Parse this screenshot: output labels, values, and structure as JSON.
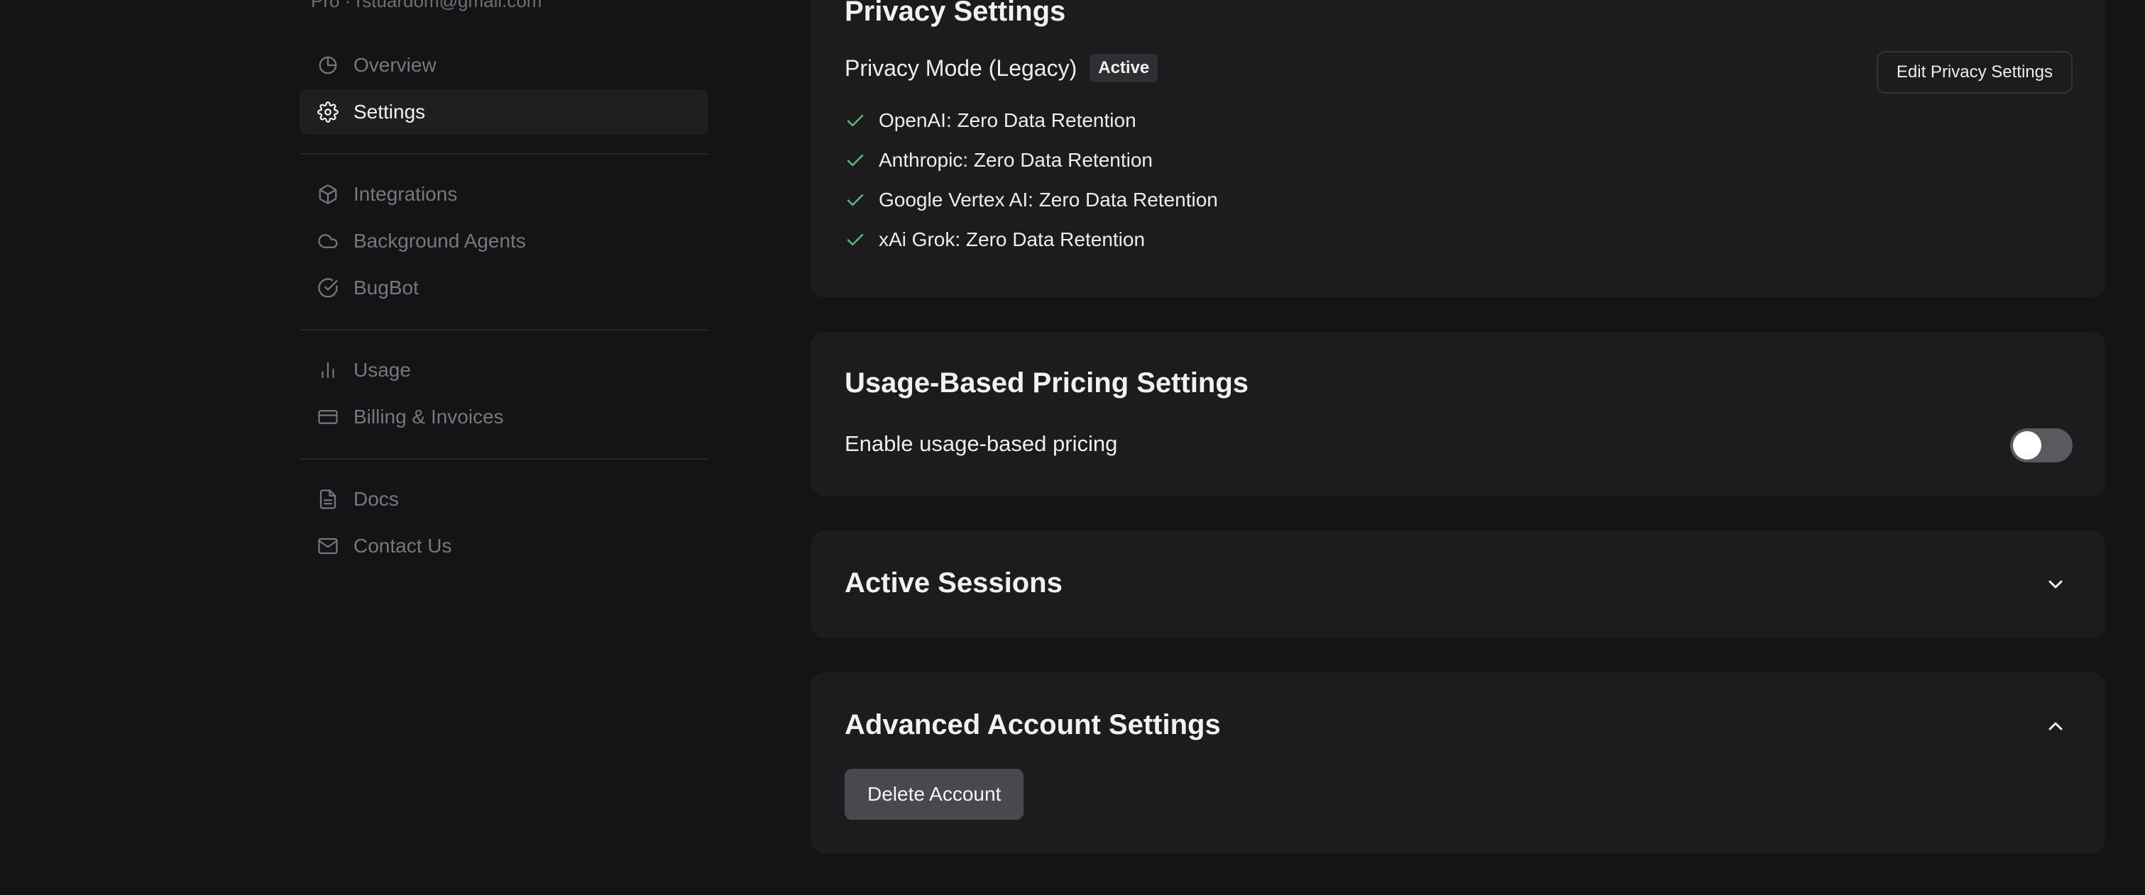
{
  "colors": {
    "background": "#141416",
    "card": "#1c1c1f",
    "sidebar_active": "#1f1f22",
    "text_primary": "#ededee",
    "text_muted": "#77777c",
    "check_green": "#5bb974",
    "toggle_off": "#5a5a5e",
    "delete_button": "#49494d"
  },
  "sidebar": {
    "account_line": "Pro · rstuardom@gmail.com",
    "items": [
      {
        "label": "Overview",
        "icon": "pie-chart-icon",
        "active": false
      },
      {
        "label": "Settings",
        "icon": "gear-icon",
        "active": true
      },
      {
        "label": "Integrations",
        "icon": "cube-icon",
        "active": false
      },
      {
        "label": "Background Agents",
        "icon": "cloud-icon",
        "active": false
      },
      {
        "label": "BugBot",
        "icon": "check-circle-icon",
        "active": false
      },
      {
        "label": "Usage",
        "icon": "bar-chart-icon",
        "active": false
      },
      {
        "label": "Billing & Invoices",
        "icon": "credit-card-icon",
        "active": false
      },
      {
        "label": "Docs",
        "icon": "document-icon",
        "active": false
      },
      {
        "label": "Contact Us",
        "icon": "mail-icon",
        "active": false
      }
    ]
  },
  "privacy": {
    "title": "Privacy Settings",
    "mode_label": "Privacy Mode (Legacy)",
    "status_badge": "Active",
    "edit_button": "Edit Privacy Settings",
    "retention": [
      "OpenAI: Zero Data Retention",
      "Anthropic: Zero Data Retention",
      "Google Vertex AI: Zero Data Retention",
      "xAi Grok: Zero Data Retention"
    ]
  },
  "usage_pricing": {
    "title": "Usage-Based Pricing Settings",
    "toggle_label": "Enable usage-based pricing",
    "enabled": false
  },
  "active_sessions": {
    "title": "Active Sessions",
    "expanded": false
  },
  "advanced_account": {
    "title": "Advanced Account Settings",
    "expanded": true,
    "delete_button": "Delete Account"
  }
}
